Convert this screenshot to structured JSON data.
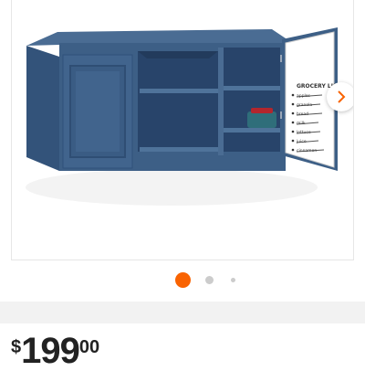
{
  "gallery": {
    "image_alt": "Blue wall cabinet with open door",
    "next_icon": "chevron-right-icon",
    "active_index": 1,
    "total_visible_dots": 3
  },
  "whiteboard": {
    "title": "GROCERY LIST",
    "items": [
      "apples",
      "granola",
      "bread",
      "milk",
      "lettuce",
      "juice",
      "cinnamon"
    ]
  },
  "price": {
    "currency": "$",
    "dollars": "199",
    "cents": "00"
  },
  "colors": {
    "accent": "#f96302",
    "cabinet_blue": "#3d5f86",
    "dot_inactive": "#cccccc"
  }
}
